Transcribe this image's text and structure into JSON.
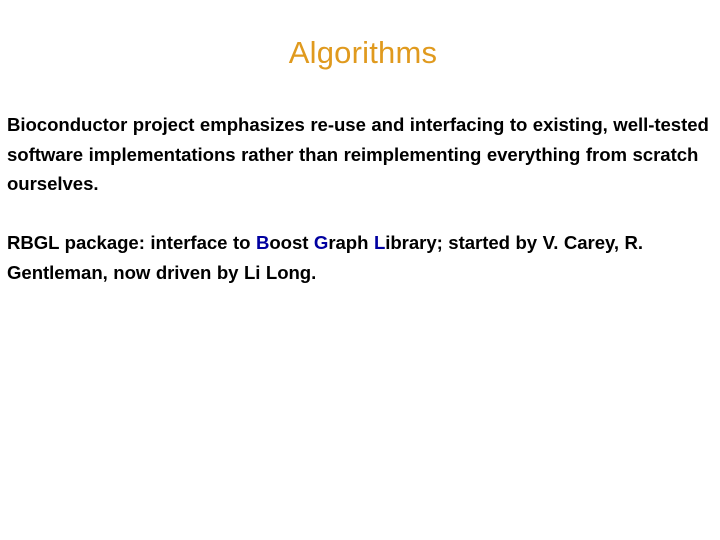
{
  "slide": {
    "title": "Algorithms",
    "title_color": "#e09a1e",
    "background_color": "#ffffff",
    "body_text_color": "#000000",
    "accent_color": "#0000a0"
  },
  "paragraphs": {
    "p1": "Bioconductor project emphasizes re-use and interfacing to existing, well-tested software implementations rather than reimplementing everything from scratch ourselves.",
    "p2": {
      "before_boost": "RBGL package: interface to ",
      "boost_initial": "B",
      "boost_rest": "oost ",
      "graph_initial": "G",
      "graph_rest": "raph ",
      "library_initial": "L",
      "library_rest": "ibrary",
      "after_library": "; started by V. Carey, R. Gentleman, now driven by Li Long."
    }
  }
}
